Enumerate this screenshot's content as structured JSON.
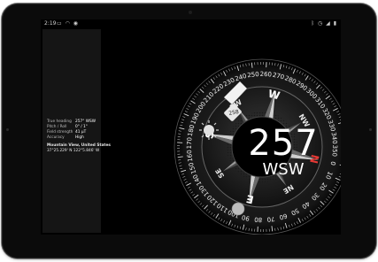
{
  "status_bar": {
    "time": "2:19",
    "left_icons": [
      "sim-icon",
      "wifi-icon",
      "location-icon"
    ],
    "right_icons": [
      "bluetooth-icon",
      "alarm-icon",
      "signal-icon",
      "battery-icon"
    ]
  },
  "info": {
    "rows": [
      {
        "label": "True heading",
        "value": "257° WSW"
      },
      {
        "label": "Pitch / Roll",
        "value": "0° / 1°"
      },
      {
        "label": "Field strength",
        "value": "41 μT"
      },
      {
        "label": "Accuracy",
        "value": "High"
      }
    ],
    "location_name": "Mountain View, United States",
    "coordinates": "37°25.229' N 122°5.846' W"
  },
  "compass": {
    "heading_value": "257",
    "heading_direction": "WSW",
    "marker_value": "258",
    "cardinals": [
      {
        "label": "N",
        "angle": 103,
        "color": "#e53935"
      },
      {
        "label": "E",
        "angle": 193,
        "color": "#ffffff"
      },
      {
        "label": "S",
        "angle": 283,
        "color": "#ffffff"
      },
      {
        "label": "W",
        "angle": 13,
        "color": "#ffffff"
      }
    ],
    "intercardinals": [
      {
        "label": "NE",
        "angle": 148
      },
      {
        "label": "SE",
        "angle": 238
      },
      {
        "label": "SW",
        "angle": 328
      },
      {
        "label": "NW",
        "angle": 58
      }
    ],
    "rotation": -257,
    "ring_numbers": [
      "0",
      "10",
      "20",
      "30",
      "40",
      "50",
      "60",
      "70",
      "80",
      "90",
      "100",
      "110",
      "120",
      "130",
      "140",
      "150",
      "160",
      "170",
      "180",
      "190",
      "200",
      "210",
      "220",
      "230",
      "240",
      "250",
      "260",
      "270",
      "280",
      "290",
      "300",
      "310",
      "320",
      "330",
      "340",
      "350"
    ],
    "sun_icon": "sun-icon",
    "moon_icon": "moon-icon"
  }
}
